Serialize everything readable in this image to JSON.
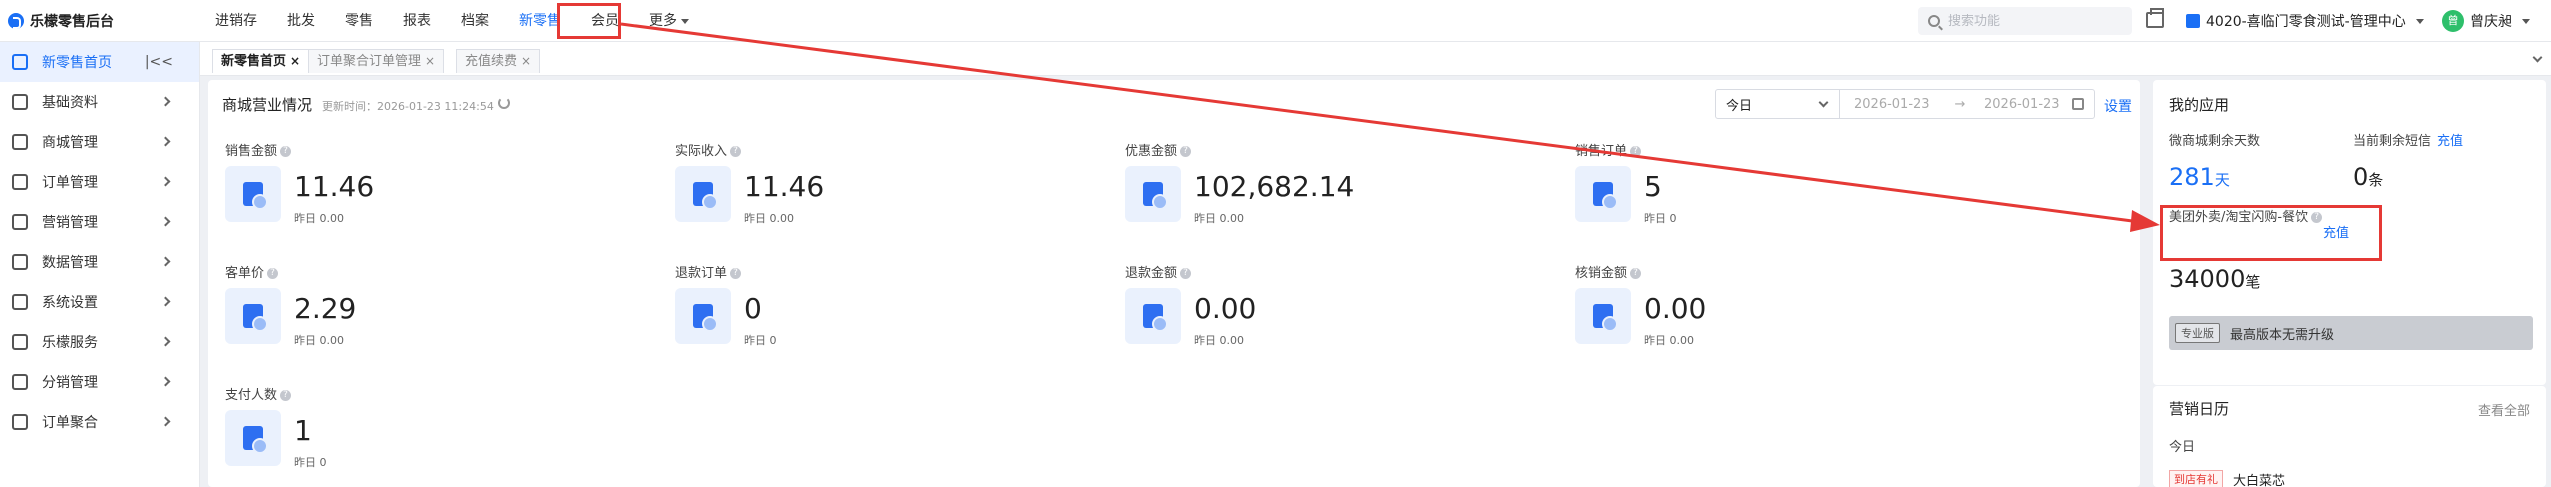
{
  "app": {
    "title": "乐檬零售后台"
  },
  "nav": {
    "items": [
      {
        "label": "进销存"
      },
      {
        "label": "批发"
      },
      {
        "label": "零售"
      },
      {
        "label": "报表"
      },
      {
        "label": "档案"
      },
      {
        "label": "新零售",
        "active": true
      },
      {
        "label": "会员"
      },
      {
        "label": "更多"
      }
    ]
  },
  "header": {
    "search_placeholder": "搜索功能",
    "store": "4020-喜临门零食测试-管理中心",
    "user_name": "曾庆昶",
    "avatar_text": "曾"
  },
  "sidebar": {
    "items": [
      {
        "label": "新零售首页",
        "active": true
      },
      {
        "label": "基础资料"
      },
      {
        "label": "商城管理"
      },
      {
        "label": "订单管理"
      },
      {
        "label": "营销管理"
      },
      {
        "label": "数据管理"
      },
      {
        "label": "系统设置"
      },
      {
        "label": "乐檬服务"
      },
      {
        "label": "分销管理"
      },
      {
        "label": "订单聚合"
      }
    ]
  },
  "tabs": [
    {
      "label": "新零售首页",
      "close": "×"
    },
    {
      "label": "订单聚合订单管理",
      "close": "×"
    },
    {
      "label": "充值续费",
      "close": "×"
    }
  ],
  "main": {
    "title": "商城营业情况",
    "updated": "更新时间：2026-01-23 11:24:54",
    "date_range": {
      "preset": "今日",
      "start": "2026-01-23",
      "arrow": "→",
      "end": "2026-01-23"
    },
    "settings_label": "设置",
    "metrics": [
      {
        "label": "销售金额",
        "value": "11.46",
        "sub": "昨日 0.00"
      },
      {
        "label": "实际收入",
        "value": "11.46",
        "sub": "昨日 0.00"
      },
      {
        "label": "优惠金额",
        "value": "102,682.14",
        "sub": "昨日 0.00"
      },
      {
        "label": "销售订单",
        "value": "5",
        "sub": "昨日 0"
      },
      {
        "label": "客单价",
        "value": "2.29",
        "sub": "昨日 0.00"
      },
      {
        "label": "退款订单",
        "value": "0",
        "sub": "昨日 0"
      },
      {
        "label": "退款金额",
        "value": "0.00",
        "sub": "昨日 0.00"
      },
      {
        "label": "核销金额",
        "value": "0.00",
        "sub": "昨日 0.00"
      },
      {
        "label": "支付人数",
        "value": "1",
        "sub": "昨日 0"
      }
    ]
  },
  "apps_panel": {
    "title": "我的应用",
    "days_label": "微商城剩余天数",
    "sms_label": "当前剩余短信",
    "sms_recharge": "充值",
    "days_value": "281",
    "days_unit": "天",
    "sms_value": "0",
    "sms_unit": "条",
    "meituan_label": "美团外卖/淘宝闪购-餐饮",
    "meituan_recharge": "充值",
    "meituan_value": "34000",
    "meituan_unit": "笔",
    "pro_tag": "专业版",
    "upgrade_text": "最高版本无需升级"
  },
  "calendar_panel": {
    "title": "营销日历",
    "view_all": "查看全部",
    "today": "今日",
    "tag": "到店有礼",
    "item": "大白菜芯"
  },
  "colors": {
    "accent": "#1a6ff5",
    "annotation": "#e53935"
  }
}
